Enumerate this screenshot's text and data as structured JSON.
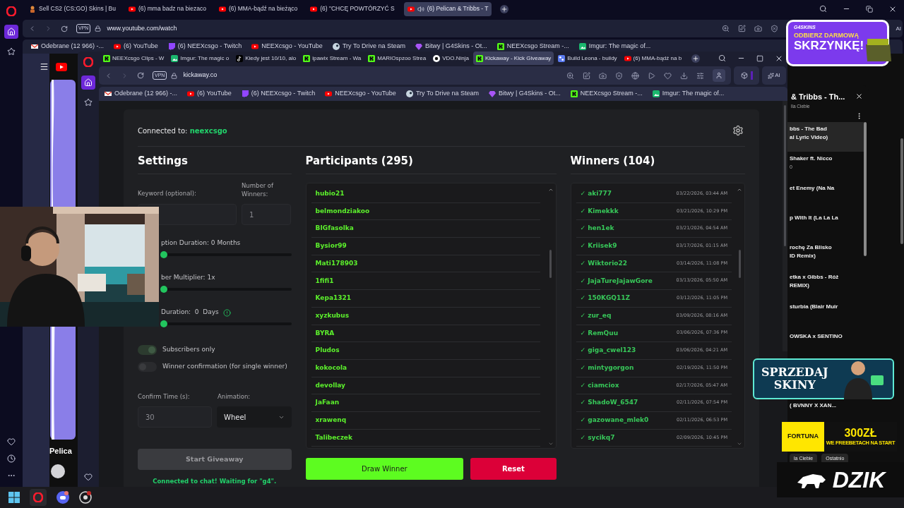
{
  "outer_browser": {
    "tabs": [
      {
        "label": "Sell CS2 (CS:GO) Skins | Bu",
        "kind": "skin",
        "playing": false,
        "selected": false
      },
      {
        "label": "(6) mma badz na biezaco",
        "kind": "youtube",
        "playing": false,
        "selected": false
      },
      {
        "label": "(6) MMA-bądź na bieżąco",
        "kind": "youtube",
        "playing": false,
        "selected": false
      },
      {
        "label": "(6) \"CHCĘ POWTÓRZYĆ S",
        "kind": "youtube",
        "playing": false,
        "selected": false
      },
      {
        "label": "(6) Pelican & Tribbs - T",
        "kind": "youtube",
        "playing": true,
        "selected": true
      }
    ],
    "address": "www.youtube.com/watch",
    "vpn_badge": "VPN",
    "ai_button": "AI",
    "bookmarks": [
      {
        "label": "Odebrane (12 966) -...",
        "kind": "gmail"
      },
      {
        "label": "(6) YouTube",
        "kind": "youtube"
      },
      {
        "label": "(6) NEEXcsgo - Twitch",
        "kind": "twitch"
      },
      {
        "label": "NEEXcsgo - YouTube",
        "kind": "youtube"
      },
      {
        "label": "Try To Drive na Steam",
        "kind": "steam"
      },
      {
        "label": "Bitwy | G4Skins - Ot...",
        "kind": "gem"
      },
      {
        "label": "NEEXcsgo Stream -...",
        "kind": "kick"
      },
      {
        "label": "Imgur: The magic of...",
        "kind": "imgur"
      }
    ]
  },
  "youtube": {
    "video_title": "Pelica",
    "panel": {
      "title": "& Tribbs - Th...",
      "subtitle": "lla Ciebie",
      "items": [
        {
          "lines": [
            "bbs - The Bad",
            "al Lyric Video)"
          ],
          "selected": true
        },
        {
          "lines": [
            "Shaker ft. Nicco"
          ],
          "meta": "0",
          "selected": false
        },
        {
          "lines": [
            "et Enemy (Na Na"
          ],
          "selected": false
        },
        {
          "lines": [
            "p With It (La La La"
          ],
          "selected": false
        },
        {
          "lines": [
            "rochę Za Blisko",
            "ID Remix)"
          ],
          "selected": false
        },
        {
          "lines": [
            "etka x Gibbs - Róż",
            "REMIX)"
          ],
          "selected": false
        },
        {
          "lines": [
            "sturbia (Blair Muir"
          ],
          "selected": false
        },
        {
          "lines": [
            "OWSKA x SENTINO"
          ],
          "selected": false
        }
      ],
      "more_items": [
        {
          "lines": [
            "( BVNNY X XAN..."
          ],
          "selected": false
        }
      ],
      "chips": [
        "la Ciebie",
        "Ostatnio"
      ]
    }
  },
  "inner_browser": {
    "tabs": [
      {
        "label": "NEEXcsgo Clips - W",
        "kind": "kick",
        "selected": false
      },
      {
        "label": "Imgur: The magic o",
        "kind": "imgur",
        "selected": false
      },
      {
        "label": "Kiedy jest 10/10, alo",
        "kind": "tiktok",
        "selected": false
      },
      {
        "label": "ipawix Stream - Wa",
        "kind": "kick",
        "selected": false
      },
      {
        "label": "MARIOspzoo Strea",
        "kind": "kick",
        "selected": false
      },
      {
        "label": "VDO.Ninja",
        "kind": "vdo",
        "selected": false
      },
      {
        "label": "Kickaway - Kick Giveaway",
        "kind": "kick",
        "selected": true
      },
      {
        "label": "Build Leona - buildy",
        "kind": "leona",
        "selected": false
      },
      {
        "label": "(6) MMA-bądź na b",
        "kind": "youtube",
        "selected": false
      }
    ],
    "address": "kickaway.co",
    "vpn_badge": "VPN",
    "ai_button": "AI",
    "bookmarks": [
      {
        "label": "Odebrane (12 966) -...",
        "kind": "gmail"
      },
      {
        "label": "(6) YouTube",
        "kind": "youtube"
      },
      {
        "label": "(6) NEEXcsgo - Twitch",
        "kind": "twitch"
      },
      {
        "label": "NEEXcsgo - YouTube",
        "kind": "youtube"
      },
      {
        "label": "Try To Drive na Steam",
        "kind": "steam"
      },
      {
        "label": "Bitwy | G4Skins - Ot...",
        "kind": "gem"
      },
      {
        "label": "NEEXcsgo Stream -...",
        "kind": "kick"
      },
      {
        "label": "Imgur: The magic of...",
        "kind": "imgur"
      }
    ]
  },
  "kickaway": {
    "connected_label": "Connected to:",
    "channel": "neexcsgo",
    "settings": {
      "title": "Settings",
      "keyword_label": "Keyword (optional):",
      "winners_label": "Number of Winners:",
      "winners_placeholder": "1",
      "sliders": [
        {
          "label": "ption Duration: 0 Months",
          "level": 0,
          "info": false
        },
        {
          "label": "ber Multiplier: 1x",
          "level": 0,
          "info": false
        },
        {
          "label": "Duration:  0  Days",
          "level": 0,
          "info": true
        }
      ],
      "toggles": [
        {
          "label": "Subscribers only",
          "on": true
        },
        {
          "label": "Winner confirmation (for single winner)",
          "on": false
        }
      ],
      "confirm_label": "Confirm Time (s):",
      "confirm_placeholder": "30",
      "animation_label": "Animation:",
      "animation_value": "Wheel",
      "start_button": "Start Giveaway",
      "status": "Connected to chat! Waiting for \"g4\"."
    },
    "participants": {
      "title": "Participants (295)",
      "names": [
        "hubio21",
        "belmondziakoo",
        "BIGfasolka",
        "Bysior99",
        "Mati178903",
        "1fifi1",
        "Kepa1321",
        "xyzkubus",
        "BYRA",
        "Pludos",
        "kokocola",
        "devollay",
        "JaFaan",
        "xrawenq",
        "Talibeczek"
      ]
    },
    "winners": {
      "title": "Winners (104)",
      "rows": [
        {
          "name": "✓ aki777",
          "time": "03/22/2026, 03:44 AM"
        },
        {
          "name": "✓ Kimekkk",
          "time": "03/21/2026, 10:29 PM"
        },
        {
          "name": "✓ hen1ek",
          "time": "03/21/2026, 04:54 AM"
        },
        {
          "name": "✓ Kriisek9",
          "time": "03/17/2026, 01:15 AM"
        },
        {
          "name": "✓ Wiktorio22",
          "time": "03/14/2026, 11:08 PM"
        },
        {
          "name": "✓ JajaTureJajawGore",
          "time": "03/13/2026, 05:50 AM"
        },
        {
          "name": "✓ 150KGQ11Z",
          "time": "03/12/2026, 11:05 PM"
        },
        {
          "name": "✓ zur_eq",
          "time": "03/09/2026, 08:16 AM"
        },
        {
          "name": "✓ RemQuu",
          "time": "03/06/2026, 07:36 PM"
        },
        {
          "name": "✓ giga_cwel123",
          "time": "03/06/2026, 04:21 AM"
        },
        {
          "name": "✓ mintygorgon",
          "time": "02/19/2026, 11:50 PM"
        },
        {
          "name": "✓ ciamciox",
          "time": "02/17/2026, 05:47 AM"
        },
        {
          "name": "✓ ShadoW_6547",
          "time": "02/11/2026, 07:54 PM"
        },
        {
          "name": "✓ gazowane_mlek0",
          "time": "02/11/2026, 06:53 PM"
        },
        {
          "name": "✓ sycikq7",
          "time": "02/09/2026, 10:45 PM"
        }
      ]
    },
    "draw_button": "Draw Winner",
    "reset_button": "Reset"
  },
  "overlays": {
    "case_ad": {
      "brand": "G4SKINS",
      "line1": "ODBIERZ DARMOWĄ",
      "line2": "SKRZYNKĘ!"
    },
    "sell_ad": {
      "line1": "SPRZEDAJ",
      "line2": "SKINY"
    },
    "bet_ad": {
      "brand": "FORTUNA",
      "amount": "300ZŁ",
      "text": "WE FREEBETACH NA START"
    },
    "sponsor": "DZIK"
  }
}
